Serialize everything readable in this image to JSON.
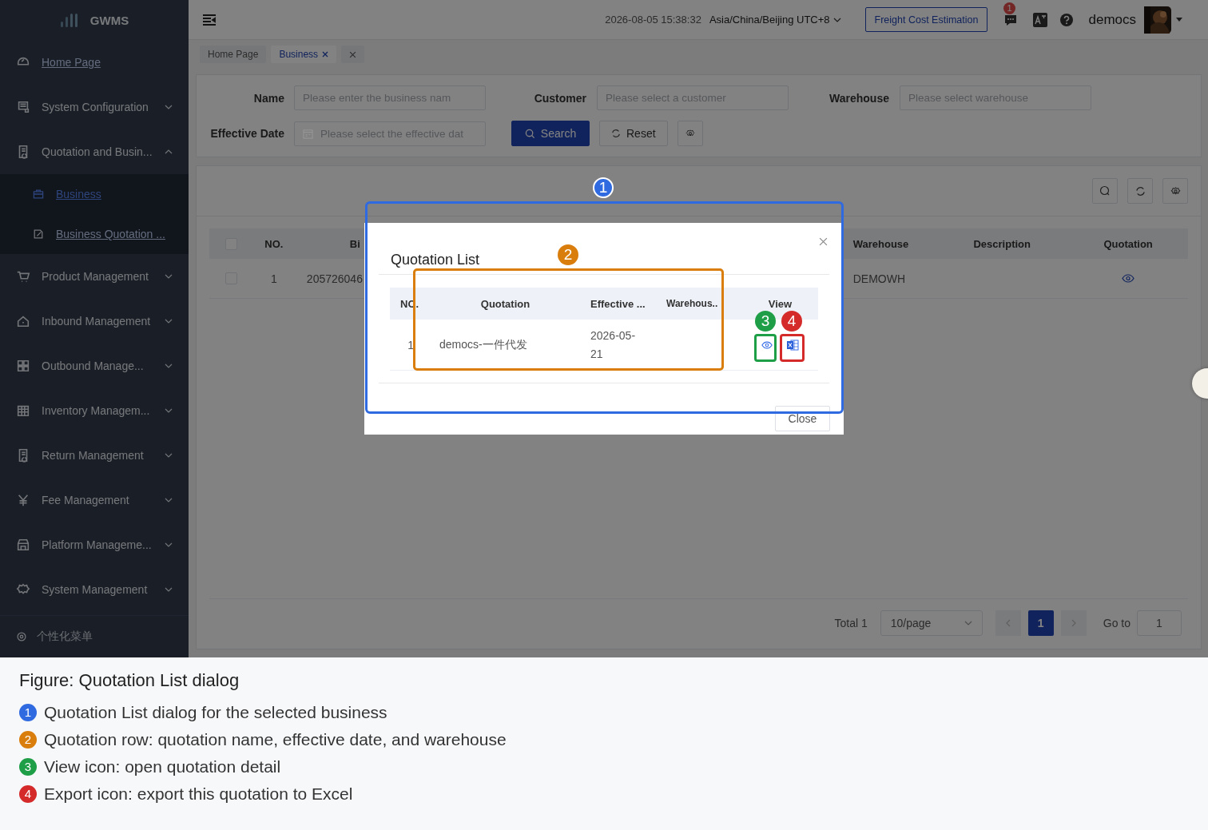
{
  "header": {
    "logo": "GWMS",
    "datetime": "2026-08-05 15:38:32",
    "timezone": "Asia/China/Beijing UTC+8",
    "freight_button": "Freight Cost Estimation",
    "notification_count": "1",
    "user": "democs"
  },
  "sidebar": {
    "items": [
      {
        "label": "Home Page",
        "underlined": true
      },
      {
        "label": "System Configuration",
        "underlined": false,
        "expanded": false
      },
      {
        "label": "Quotation and Busin...",
        "underlined": false,
        "expanded": true,
        "children": [
          {
            "label": "Business",
            "selected": true,
            "underlined": true
          },
          {
            "label": "Business Quotation ...",
            "selected": false,
            "underlined": true
          }
        ]
      },
      {
        "label": "Product Management",
        "underlined": false,
        "expanded": false
      },
      {
        "label": "Inbound Management",
        "underlined": false,
        "expanded": false
      },
      {
        "label": "Outbound Manage...",
        "underlined": false,
        "expanded": false
      },
      {
        "label": "Inventory Managem...",
        "underlined": false,
        "expanded": false
      },
      {
        "label": "Return Management",
        "underlined": false,
        "expanded": false
      },
      {
        "label": "Fee Management",
        "underlined": false,
        "expanded": false
      },
      {
        "label": "Platform Manageme...",
        "underlined": false,
        "expanded": false
      },
      {
        "label": "System Management",
        "underlined": false,
        "expanded": false
      }
    ],
    "footer": "个性化菜单"
  },
  "tabs": [
    {
      "label": "Home Page",
      "selected": false,
      "closable": false
    },
    {
      "label": "Business",
      "selected": true,
      "closable": true
    }
  ],
  "filters": [
    {
      "label": "Name",
      "placeholder": "Please enter the business nam",
      "kind": "text"
    },
    {
      "label": "Customer",
      "placeholder": "Please select a customer",
      "kind": "text"
    },
    {
      "label": "Warehouse",
      "placeholder": "Please select warehouse",
      "kind": "text"
    },
    {
      "label": "Effective Date",
      "placeholder": "Please select the effective dat",
      "kind": "date"
    }
  ],
  "filter_buttons": {
    "search": "Search",
    "reset": "Reset"
  },
  "table": {
    "all_checked": false,
    "columns": [
      "NO.",
      "Bi",
      "Warehouse",
      "Description",
      "Quotation"
    ],
    "rows": [
      {
        "checked": false,
        "no": "1",
        "business": "205726046",
        "warehouse": "DEMOWH",
        "description": ""
      }
    ]
  },
  "pagination": {
    "total": "Total 1",
    "page_size": "10/page",
    "pages": [
      {
        "label": "1",
        "selected": true
      }
    ],
    "goto_label": "Go to",
    "goto_value": "1"
  },
  "dialog": {
    "title": "Quotation List",
    "columns": [
      "NO.",
      "Quotation",
      "Effective ...",
      "Warehous..",
      "View"
    ],
    "rows": [
      {
        "no": "1",
        "quotation": "democs-一件代发",
        "effective": "2026-05-21"
      }
    ],
    "close_button": "Close"
  },
  "annotations": [
    {
      "number": "1",
      "color": "#2f6ae0"
    },
    {
      "number": "2",
      "color": "#d97d0d"
    },
    {
      "number": "3",
      "color": "#1e9e47"
    },
    {
      "number": "4",
      "color": "#d42a2a"
    }
  ],
  "caption": {
    "title": "Figure: Quotation List dialog",
    "items": [
      {
        "number": "1",
        "color": "#2f6ae0",
        "text": "Quotation List dialog for the selected business"
      },
      {
        "number": "2",
        "color": "#d97d0d",
        "text": "Quotation row: quotation name, effective date, and warehouse"
      },
      {
        "number": "3",
        "color": "#1e9e47",
        "text": "View icon: open quotation detail"
      },
      {
        "number": "4",
        "color": "#d42a2a",
        "text": "Export icon: export this quotation to Excel"
      }
    ]
  }
}
